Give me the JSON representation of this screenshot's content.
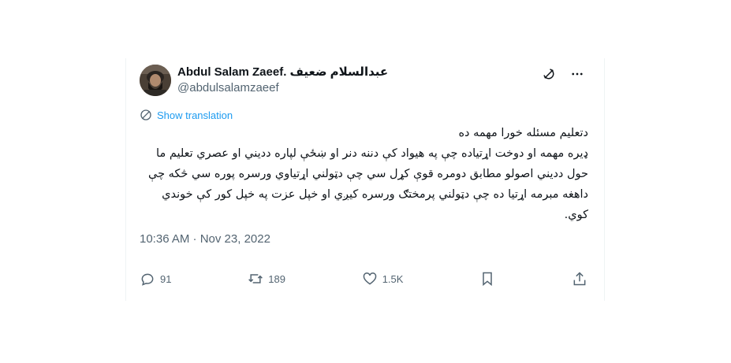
{
  "author": {
    "display_name": "Abdul Salam Zaeef. عبدالسلام ضعیف",
    "handle": "@abdulsalamzaeef",
    "avatar_icon": "user-avatar"
  },
  "header_icons": [
    "grok-icon",
    "more-icon"
  ],
  "translation": {
    "label": "Show translation",
    "icon": "globe-icon",
    "color": "#1d9bf0"
  },
  "tweet": {
    "text": "دتعلیم مسئله خورا مهمه ده\nډیره مهمه او دوخت اړتیاده  چې په هیواد کې دننه دنر او ښځې لپاره ددیني او عصري تعلیم ما حول ددیني اصولو مطابق دومره قوې کړل سي چې دټولني اړتیاوي ورسره پوره سي څکه چې داهغه مبرمه اړتیا ده چې دټولني پرمختګ ورسره کیږي او خپل عزت په خپل کور کې خوندي کوي."
  },
  "timestamp": "10:36 AM · Nov 23, 2022",
  "actions": {
    "reply": {
      "icon": "reply-icon",
      "count": "91"
    },
    "retweet": {
      "icon": "retweet-icon",
      "count": "189"
    },
    "like": {
      "icon": "heart-icon",
      "count": "1.5K"
    },
    "bookmark": {
      "icon": "bookmark-icon"
    },
    "share": {
      "icon": "share-icon"
    }
  },
  "colors": {
    "text": "#0f1419",
    "secondary": "#536471",
    "accent": "#1d9bf0"
  }
}
